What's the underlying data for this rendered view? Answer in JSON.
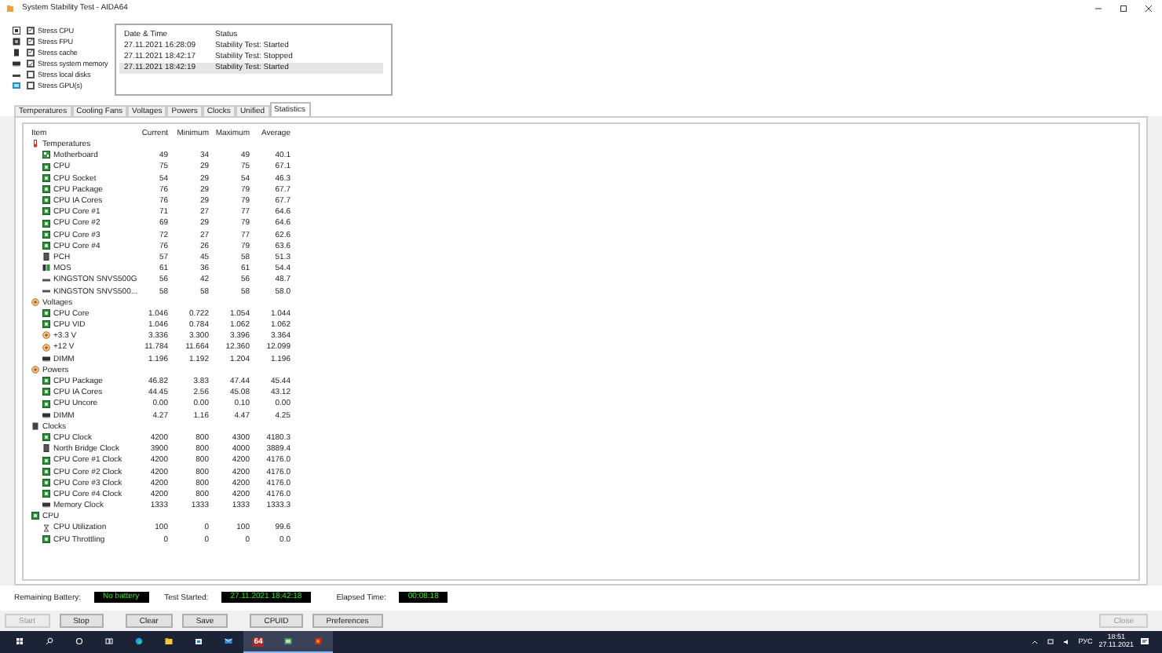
{
  "window": {
    "title": "System Stability Test - AIDA64"
  },
  "stress_options": [
    {
      "kind": "cpu",
      "label": "Stress CPU",
      "checked": true
    },
    {
      "kind": "fpu",
      "label": "Stress FPU",
      "checked": true
    },
    {
      "kind": "cache",
      "label": "Stress cache",
      "checked": true
    },
    {
      "kind": "memory",
      "label": "Stress system memory",
      "checked": true
    },
    {
      "kind": "disk",
      "label": "Stress local disks",
      "checked": false
    },
    {
      "kind": "gpu",
      "label": "Stress GPU(s)",
      "checked": false
    }
  ],
  "log": {
    "columns": [
      "Date & Time",
      "Status"
    ],
    "rows": [
      {
        "date": "27.11.2021 16:28:09",
        "status": "Stability Test: Started",
        "selected": false
      },
      {
        "date": "27.11.2021 18:42:17",
        "status": "Stability Test: Stopped",
        "selected": false
      },
      {
        "date": "27.11.2021 18:42:19",
        "status": "Stability Test: Started",
        "selected": true
      }
    ]
  },
  "tabs": [
    {
      "label": "Temperatures",
      "selected": false
    },
    {
      "label": "Cooling Fans",
      "selected": false
    },
    {
      "label": "Voltages",
      "selected": false
    },
    {
      "label": "Powers",
      "selected": false
    },
    {
      "label": "Clocks",
      "selected": false
    },
    {
      "label": "Unified",
      "selected": false
    },
    {
      "label": "Statistics",
      "selected": true
    }
  ],
  "statistics": {
    "columns": [
      "Item",
      "Current",
      "Minimum",
      "Maximum",
      "Average"
    ],
    "groups": [
      {
        "label": "Temperatures",
        "kind": "temp",
        "children": [
          {
            "kind": "board",
            "label": "Motherboard",
            "current": "49",
            "minimum": "34",
            "maximum": "49",
            "average": "40.1"
          },
          {
            "kind": "chip",
            "label": "CPU",
            "current": "75",
            "minimum": "29",
            "maximum": "75",
            "average": "67.1"
          },
          {
            "kind": "chip",
            "label": "CPU Socket",
            "current": "54",
            "minimum": "29",
            "maximum": "54",
            "average": "46.3"
          },
          {
            "kind": "chip",
            "label": "CPU Package",
            "current": "76",
            "minimum": "29",
            "maximum": "79",
            "average": "67.7"
          },
          {
            "kind": "chip",
            "label": "CPU IA Cores",
            "current": "76",
            "minimum": "29",
            "maximum": "79",
            "average": "67.7"
          },
          {
            "kind": "chip",
            "label": "CPU Core #1",
            "current": "71",
            "minimum": "27",
            "maximum": "77",
            "average": "64.6"
          },
          {
            "kind": "chip",
            "label": "CPU Core #2",
            "current": "69",
            "minimum": "29",
            "maximum": "79",
            "average": "64.6"
          },
          {
            "kind": "chip",
            "label": "CPU Core #3",
            "current": "72",
            "minimum": "27",
            "maximum": "77",
            "average": "62.6"
          },
          {
            "kind": "chip",
            "label": "CPU Core #4",
            "current": "76",
            "minimum": "26",
            "maximum": "79",
            "average": "63.6"
          },
          {
            "kind": "pch",
            "label": "PCH",
            "current": "57",
            "minimum": "45",
            "maximum": "58",
            "average": "51.3"
          },
          {
            "kind": "mos",
            "label": "MOS",
            "current": "61",
            "minimum": "36",
            "maximum": "61",
            "average": "54.4"
          },
          {
            "kind": "drive",
            "label": "KINGSTON SNVS500G",
            "current": "56",
            "minimum": "42",
            "maximum": "56",
            "average": "48.7"
          },
          {
            "kind": "drive",
            "label": "KINGSTON SNVS500...",
            "current": "58",
            "minimum": "58",
            "maximum": "58",
            "average": "58.0"
          }
        ]
      },
      {
        "label": "Voltages",
        "kind": "volt",
        "children": [
          {
            "kind": "chip",
            "label": "CPU Core",
            "current": "1.046",
            "minimum": "0.722",
            "maximum": "1.054",
            "average": "1.044"
          },
          {
            "kind": "chip",
            "label": "CPU VID",
            "current": "1.046",
            "minimum": "0.784",
            "maximum": "1.062",
            "average": "1.062"
          },
          {
            "kind": "volt",
            "label": "+3.3 V",
            "current": "3.336",
            "minimum": "3.300",
            "maximum": "3.396",
            "average": "3.364"
          },
          {
            "kind": "volt",
            "label": "+12 V",
            "current": "11.784",
            "minimum": "11.664",
            "maximum": "12.360",
            "average": "12.099"
          },
          {
            "kind": "memory",
            "label": "DIMM",
            "current": "1.196",
            "minimum": "1.192",
            "maximum": "1.204",
            "average": "1.196"
          }
        ]
      },
      {
        "label": "Powers",
        "kind": "volt",
        "children": [
          {
            "kind": "chip",
            "label": "CPU Package",
            "current": "46.82",
            "minimum": "3.83",
            "maximum": "47.44",
            "average": "45.44"
          },
          {
            "kind": "chip",
            "label": "CPU IA Cores",
            "current": "44.45",
            "minimum": "2.56",
            "maximum": "45.08",
            "average": "43.12"
          },
          {
            "kind": "chip",
            "label": "CPU Uncore",
            "current": "0.00",
            "minimum": "0.00",
            "maximum": "0.10",
            "average": "0.00"
          },
          {
            "kind": "memory",
            "label": "DIMM",
            "current": "4.27",
            "minimum": "1.16",
            "maximum": "4.47",
            "average": "4.25"
          }
        ]
      },
      {
        "label": "Clocks",
        "kind": "clock",
        "children": [
          {
            "kind": "chip",
            "label": "CPU Clock",
            "current": "4200",
            "minimum": "800",
            "maximum": "4300",
            "average": "4180.3"
          },
          {
            "kind": "pch",
            "label": "North Bridge Clock",
            "current": "3900",
            "minimum": "800",
            "maximum": "4000",
            "average": "3889.4"
          },
          {
            "kind": "chip",
            "label": "CPU Core #1 Clock",
            "current": "4200",
            "minimum": "800",
            "maximum": "4200",
            "average": "4176.0"
          },
          {
            "kind": "chip",
            "label": "CPU Core #2 Clock",
            "current": "4200",
            "minimum": "800",
            "maximum": "4200",
            "average": "4176.0"
          },
          {
            "kind": "chip",
            "label": "CPU Core #3 Clock",
            "current": "4200",
            "minimum": "800",
            "maximum": "4200",
            "average": "4176.0"
          },
          {
            "kind": "chip",
            "label": "CPU Core #4 Clock",
            "current": "4200",
            "minimum": "800",
            "maximum": "4200",
            "average": "4176.0"
          },
          {
            "kind": "memory",
            "label": "Memory Clock",
            "current": "1333",
            "minimum": "1333",
            "maximum": "1333",
            "average": "1333.3"
          }
        ]
      },
      {
        "label": "CPU",
        "kind": "chip",
        "children": [
          {
            "kind": "timer",
            "label": "CPU Utilization",
            "current": "100",
            "minimum": "0",
            "maximum": "100",
            "average": "99.6"
          },
          {
            "kind": "chip",
            "label": "CPU Throttling",
            "current": "0",
            "minimum": "0",
            "maximum": "0",
            "average": "0.0"
          }
        ]
      }
    ]
  },
  "status": [
    {
      "label": "Remaining Battery:",
      "value": "No battery"
    },
    {
      "label": "Test Started:",
      "value": "27.11.2021 18:42:18"
    },
    {
      "label": "Elapsed Time:",
      "value": "00:08:18"
    }
  ],
  "buttons": [
    {
      "label": "Start",
      "disabled": true
    },
    {
      "label": "Stop",
      "disabled": false
    },
    {
      "label": "Clear",
      "disabled": false
    },
    {
      "label": "Save",
      "disabled": false
    },
    {
      "label": "CPUID",
      "disabled": false
    },
    {
      "label": "Preferences",
      "disabled": false
    }
  ],
  "close_button": {
    "label": "Close",
    "disabled": true
  },
  "taskbar": {
    "apps": [
      {
        "kind": "start",
        "selected": false
      },
      {
        "kind": "search",
        "selected": false
      },
      {
        "kind": "cortana",
        "selected": false
      },
      {
        "kind": "taskview",
        "selected": false
      },
      {
        "kind": "edge",
        "selected": false
      },
      {
        "kind": "folder",
        "selected": false
      },
      {
        "kind": "store",
        "selected": false
      },
      {
        "kind": "mail",
        "selected": false
      },
      {
        "kind": "aida",
        "label": "64",
        "selected": true
      },
      {
        "kind": "green",
        "selected": true
      },
      {
        "kind": "red",
        "selected": true
      }
    ],
    "tray": {
      "language": "РУС",
      "time": "18:51",
      "date": "27.11.2021"
    }
  }
}
